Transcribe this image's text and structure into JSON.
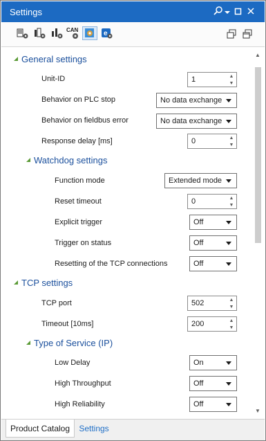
{
  "window": {
    "title": "Settings"
  },
  "toolbar": {
    "icons": [
      "module-settings-icon",
      "module-settings-icon-2",
      "module-settings-icon-3",
      "can-settings-icon",
      "network-settings-icon",
      "fieldbus-icon",
      "restore-icon",
      "restore-window-icon"
    ],
    "can_label": "CAN"
  },
  "general": {
    "header": "General settings",
    "unit_id_label": "Unit-ID",
    "unit_id_value": "1",
    "plc_stop_label": "Behavior on PLC stop",
    "plc_stop_value": "No data exchange",
    "fieldbus_error_label": "Behavior on fieldbus error",
    "fieldbus_error_value": "No data exchange",
    "response_delay_label": "Response delay [ms]",
    "response_delay_value": "0"
  },
  "watchdog": {
    "header": "Watchdog settings",
    "function_mode_label": "Function mode",
    "function_mode_value": "Extended mode",
    "reset_timeout_label": "Reset timeout",
    "reset_timeout_value": "0",
    "explicit_trigger_label": "Explicit trigger",
    "explicit_trigger_value": "Off",
    "trigger_status_label": "Trigger on status",
    "trigger_status_value": "Off",
    "resetting_tcp_label": "Resetting of the TCP connections",
    "resetting_tcp_value": "Off"
  },
  "tcp": {
    "header": "TCP settings",
    "port_label": "TCP port",
    "port_value": "502",
    "timeout_label": "Timeout [10ms]",
    "timeout_value": "200"
  },
  "tos": {
    "header": "Type of Service (IP)",
    "low_delay_label": "Low Delay",
    "low_delay_value": "On",
    "high_throughput_label": "High Throughput",
    "high_throughput_value": "Off",
    "high_reliability_label": "High Reliability",
    "high_reliability_value": "Off"
  },
  "tabs": {
    "product_catalog": "Product Catalog",
    "settings": "Settings"
  },
  "colors": {
    "titlebar": "#1c6ac2",
    "section_header": "#1a4f9c",
    "expander": "#5a9a35",
    "active_tab": "#1f6fc7"
  }
}
